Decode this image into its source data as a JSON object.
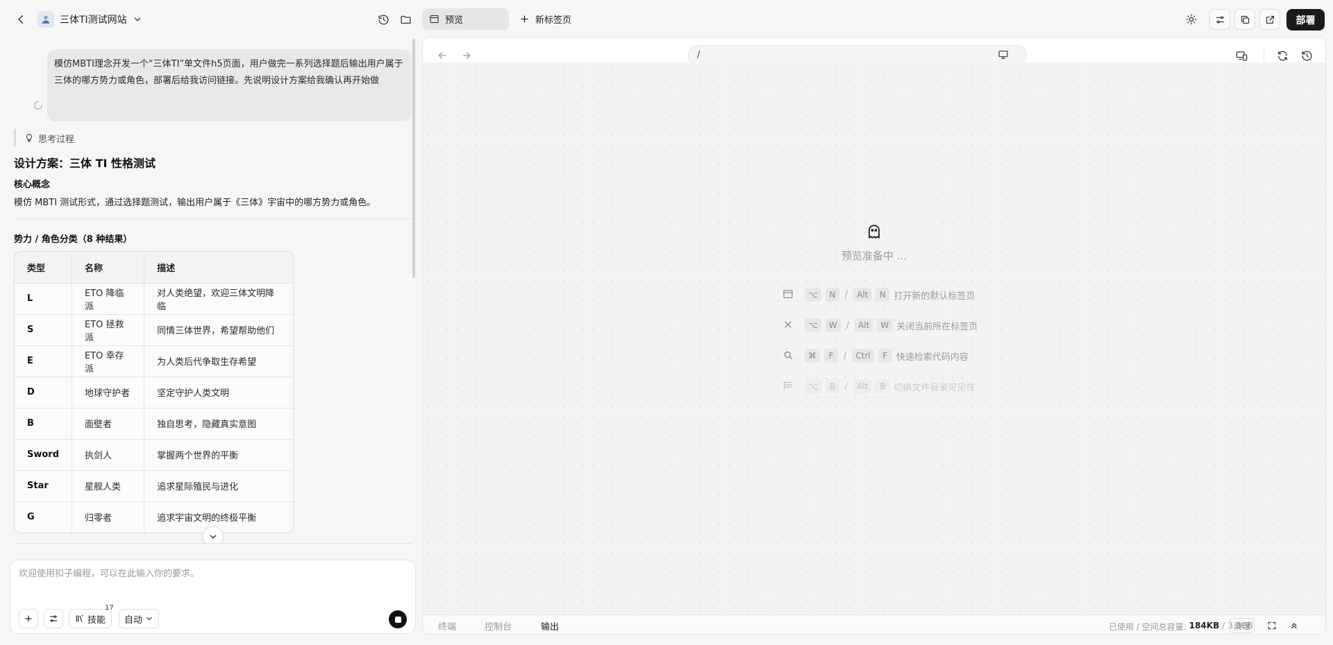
{
  "header": {
    "project_name": "三体TI测试网站",
    "tabs": [
      {
        "label": "预览"
      },
      {
        "label": "新标签页"
      }
    ],
    "deploy_label": "部署"
  },
  "chat": {
    "user_message": "模仿MBTI理念开发一个“三体TI”单文件h5页面，用户做完一系列选择题后输出用户属于三体的哪方势力或角色，部署后给我访问链接。先说明设计方案给我确认再开始做",
    "thinking_label": "思考过程",
    "design_title": "设计方案：三体 TI 性格测试",
    "core_heading": "核心概念",
    "core_desc": "模仿 MBTI 测试形式，通过选择题测试，输出用户属于《三体》宇宙中的哪方势力或角色。",
    "faction_heading": "势力 / 角色分类（8 种结果）",
    "table": {
      "headers": [
        "类型",
        "名称",
        "描述"
      ],
      "rows": [
        [
          "L",
          "ETO 降临派",
          "对人类绝望，欢迎三体文明降临"
        ],
        [
          "S",
          "ETO 拯救派",
          "同情三体世界，希望帮助他们"
        ],
        [
          "E",
          "ETO 幸存派",
          "为人类后代争取生存希望"
        ],
        [
          "D",
          "地球守护者",
          "坚定守护人类文明"
        ],
        [
          "B",
          "面壁者",
          "独自思考，隐藏真实意图"
        ],
        [
          "Sword",
          "执剑人",
          "掌握两个世界的平衡"
        ],
        [
          "Star",
          "星舰人类",
          "追求星际殖民与进化"
        ],
        [
          "G",
          "归零者",
          "追求宇宙文明的终极平衡"
        ]
      ]
    }
  },
  "composer": {
    "placeholder": "欢迎使用扣子编程，可以在此输入你的要求。",
    "skills_label": "技能",
    "skills_count": "17",
    "mode_label": "自动"
  },
  "preview": {
    "url": "/",
    "status": "预览准备中 ...",
    "shortcuts": [
      {
        "icon": "browser-tab-icon",
        "mac": [
          "⌥",
          "N"
        ],
        "win": [
          "Alt",
          "N"
        ],
        "desc": "打开新的默认标签页"
      },
      {
        "icon": "close-icon",
        "mac": [
          "⌥",
          "W"
        ],
        "win": [
          "Alt",
          "W"
        ],
        "desc": "关闭当前所在标签页"
      },
      {
        "icon": "search-icon",
        "mac": [
          "⌘",
          "F"
        ],
        "win": [
          "Ctrl",
          "F"
        ],
        "desc": "快速检索代码内容"
      },
      {
        "icon": "file-tree-icon",
        "mac": [
          "⌥",
          "B"
        ],
        "win": [
          "Alt",
          "B"
        ],
        "desc": "切换文件目录可见性"
      }
    ],
    "bottom_tabs": [
      "终端",
      "控制台",
      "输出"
    ],
    "active_bottom_tab": "输出",
    "storage_label": "已使用 / 空间总容量:",
    "storage_used": "184KB",
    "storage_sep": "/",
    "storage_total": "3.0GB",
    "clear_label": "清理"
  }
}
